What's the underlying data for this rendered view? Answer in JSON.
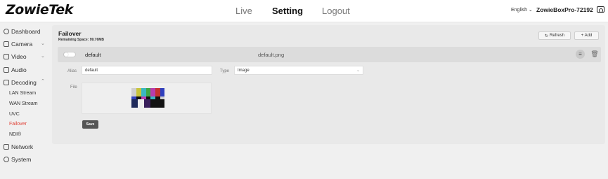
{
  "header": {
    "logo": "ZowieTek",
    "nav": {
      "live": "Live",
      "setting": "Setting",
      "logout": "Logout"
    },
    "language": "English",
    "device_name": "ZowieBoxPro-72192"
  },
  "sidebar": {
    "dashboard": "Dashboard",
    "camera": "Camera",
    "video": "Video",
    "audio": "Audio",
    "decoding": "Decoding",
    "decoding_items": [
      "LAN Stream",
      "WAN Stream",
      "UVC",
      "Failover",
      "NDI®"
    ],
    "network": "Network",
    "system": "System"
  },
  "failover": {
    "title": "Failover",
    "remaining": "Remaining Space: 99.76MB",
    "refresh_label": "Refresh",
    "add_label": "+ Add",
    "row": {
      "name": "default",
      "file": "default.png",
      "enabled": false
    },
    "alias_label": "Alias",
    "alias_value": "default",
    "type_label": "Type",
    "type_value": "Image",
    "file_label": "File",
    "save_label": "Save"
  },
  "colors": {
    "active": "#e0453a",
    "row_bg": "#dcdcdc",
    "panel_bg": "#e9e9e9",
    "save_bg": "#555555"
  },
  "icons": {
    "dashboard": "dashboard-icon",
    "camera": "camera-icon",
    "video": "video-icon",
    "audio": "audio-icon",
    "decoding": "decoding-icon",
    "network": "network-icon",
    "system": "system-gear-icon",
    "refresh": "refresh-icon",
    "row_settings": "sliders-icon",
    "row_delete": "trash-icon",
    "screenshot": "camera-icon"
  }
}
